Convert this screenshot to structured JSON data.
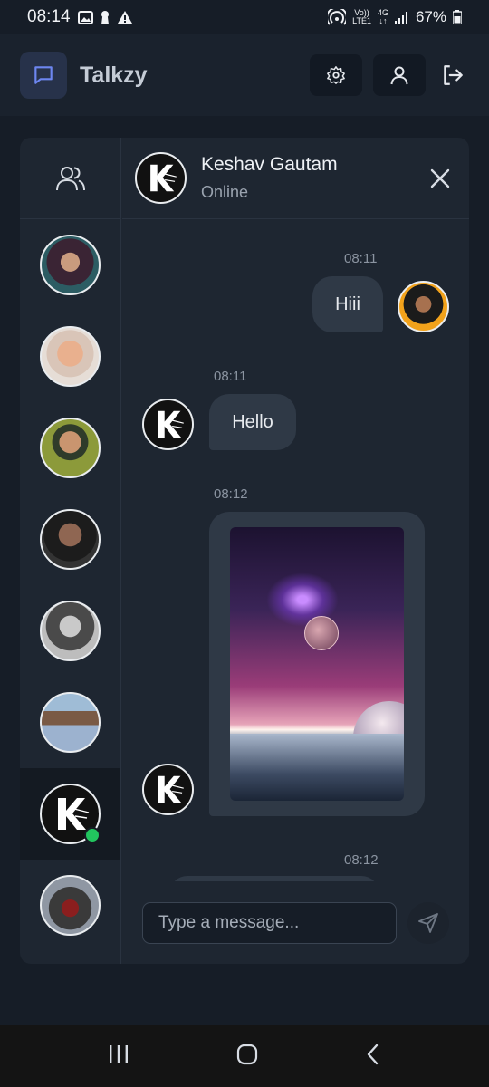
{
  "status_bar": {
    "time": "08:14",
    "volte": "Vo))",
    "lte": "LTE1",
    "network": "4G",
    "battery": "67%"
  },
  "app": {
    "title": "Talkzy"
  },
  "chat": {
    "contact_name": "Keshav Gautam",
    "contact_status": "Online",
    "messages": [
      {
        "time": "08:11",
        "text": "Hiii",
        "sender": "me"
      },
      {
        "time": "08:11",
        "text": "Hello",
        "sender": "contact"
      },
      {
        "time": "08:12",
        "type": "image",
        "sender": "contact"
      },
      {
        "time": "08:12",
        "sender": "me"
      }
    ]
  },
  "composer": {
    "placeholder": "Type a message..."
  },
  "colors": {
    "accent": "#4f6bd8",
    "online": "#22c55e",
    "background": "#161d27",
    "bubble": "#2f3946"
  }
}
